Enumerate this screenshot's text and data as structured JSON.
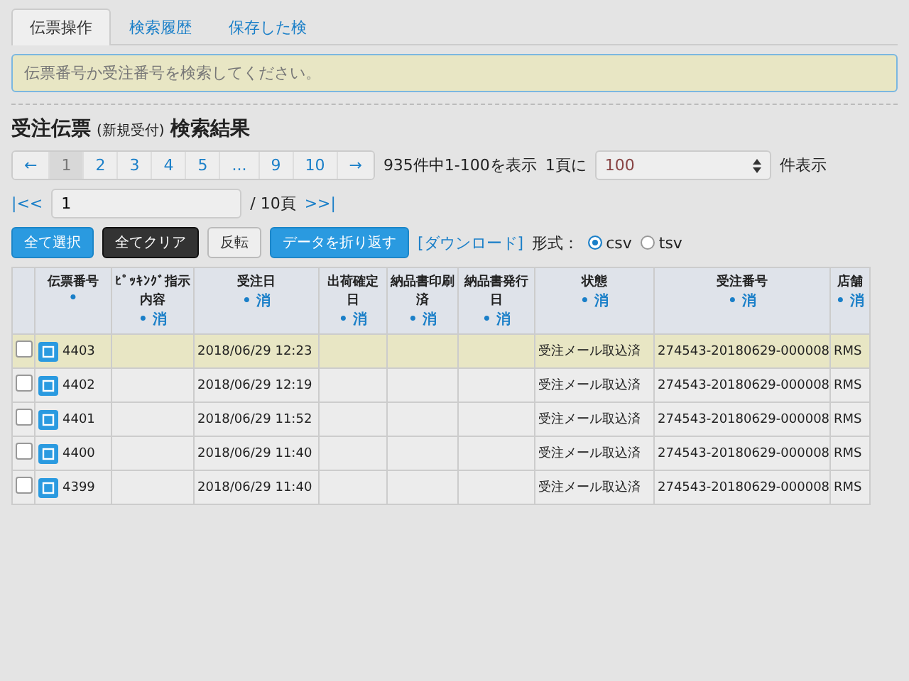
{
  "tabs": [
    {
      "label": "伝票操作",
      "selected": true
    },
    {
      "label": "検索履歴",
      "selected": false
    },
    {
      "label": "保存した検",
      "selected": false
    }
  ],
  "search": {
    "placeholder": "伝票番号か受注番号を検索してください。"
  },
  "heading": {
    "title": "受注伝票",
    "subtitle": "(新規受付)",
    "suffix": "検索結果"
  },
  "pagination": [
    {
      "label": "←",
      "selected": false
    },
    {
      "label": "1",
      "selected": true
    },
    {
      "label": "2",
      "selected": false
    },
    {
      "label": "3",
      "selected": false
    },
    {
      "label": "4",
      "selected": false
    },
    {
      "label": "5",
      "selected": false
    },
    {
      "label": "...",
      "selected": false
    },
    {
      "label": "9",
      "selected": false
    },
    {
      "label": "10",
      "selected": false
    },
    {
      "label": "→",
      "selected": false
    }
  ],
  "page_jump": {
    "first": "|<<",
    "value": "1",
    "total": "/ 10頁",
    "last": ">>|"
  },
  "summary": "935件中1-100を表示",
  "per_page": {
    "label": "1頁に",
    "value": "100",
    "suffix": "件表示"
  },
  "buttons": [
    {
      "label": "全て選択",
      "kind": "primary"
    },
    {
      "label": "全てクリア",
      "kind": "dark"
    },
    {
      "label": "反転",
      "kind": "plain"
    },
    {
      "label": "データを折り返す",
      "kind": "primary"
    }
  ],
  "download": {
    "link": "[ダウンロード]",
    "format_label": "形式：",
    "formats": [
      {
        "label": "csv",
        "selected": true
      },
      {
        "label": "tsv",
        "selected": false
      }
    ]
  },
  "columns": [
    {
      "label": "伝票番号",
      "mark": "•"
    },
    {
      "label": "ﾋﾟｯｷﾝｸﾞ指示内容",
      "mark": "•",
      "link": "消"
    },
    {
      "label": "受注日",
      "mark": "•",
      "link": "消"
    },
    {
      "label": "出荷確定日",
      "mark": "•",
      "link": "消"
    },
    {
      "label": "納品書印刷済",
      "mark": "•",
      "link": "消"
    },
    {
      "label": "納品書発行日",
      "mark": "•",
      "link": "消"
    },
    {
      "label": "状態",
      "mark": "•",
      "link": "消"
    },
    {
      "label": "受注番号",
      "mark": "•",
      "link": "消"
    },
    {
      "label": "店舗",
      "mark": "•",
      "link": "消"
    }
  ],
  "rows": [
    {
      "id": "4403",
      "date": "2018/06/29 12:23",
      "status": "受注メール取込済",
      "order": "274543-20180629-000008",
      "store": "RMS",
      "checked": false,
      "selected": true
    },
    {
      "id": "4402",
      "date": "2018/06/29 12:19",
      "status": "受注メール取込済",
      "order": "274543-20180629-000008",
      "store": "RMS",
      "checked": false,
      "selected": false
    },
    {
      "id": "4401",
      "date": "2018/06/29 11:52",
      "status": "受注メール取込済",
      "order": "274543-20180629-000008",
      "store": "RMS",
      "checked": false,
      "selected": false
    },
    {
      "id": "4400",
      "date": "2018/06/29 11:40",
      "status": "受注メール取込済",
      "order": "274543-20180629-000008",
      "store": "RMS",
      "checked": false,
      "selected": false
    },
    {
      "id": "4399",
      "date": "2018/06/29 11:40",
      "status": "受注メール取込済",
      "order": "274543-20180629-000008",
      "store": "RMS",
      "checked": false,
      "selected": false
    }
  ]
}
